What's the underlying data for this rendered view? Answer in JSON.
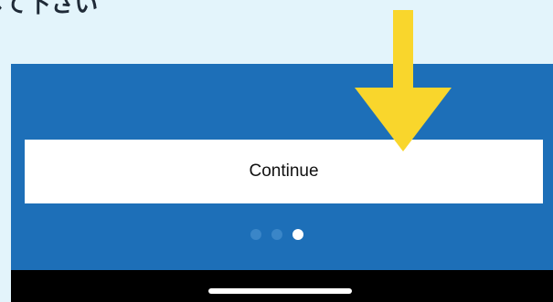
{
  "caption": {
    "text": "して下さい"
  },
  "screen": {
    "continue_label": "Continue",
    "pager": {
      "total": 3,
      "active_index": 3
    },
    "background_color": "#1d6fb8",
    "nav_bar_color": "#000000"
  },
  "annotation": {
    "icon": "arrow-down-icon",
    "color": "#f9d62c"
  },
  "icons": {
    "pager_dots": "pager-dots",
    "home_indicator": "home-indicator-bar"
  }
}
